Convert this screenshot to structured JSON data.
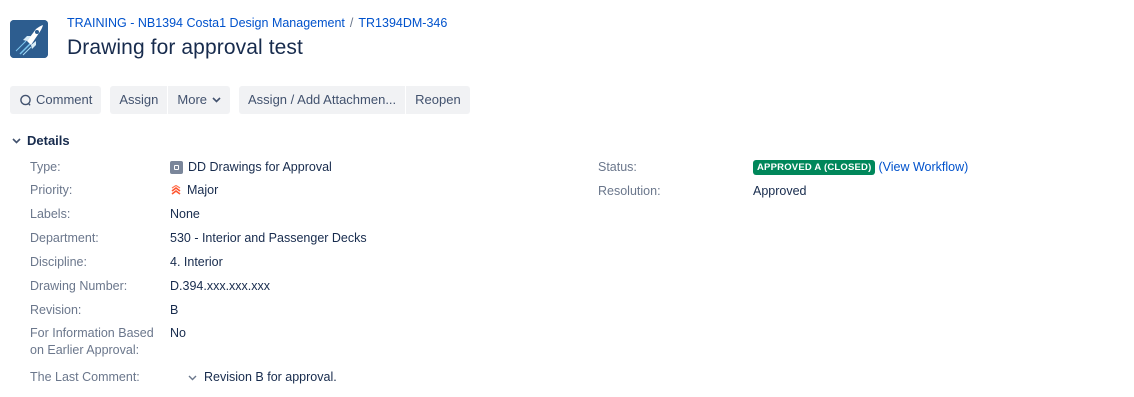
{
  "header": {
    "project_link": "TRAINING - NB1394 Costa1 Design Management",
    "separator": "/",
    "issue_key": "TR1394DM-346",
    "title": "Drawing for approval test",
    "avatar_icon": "rocket-icon"
  },
  "toolbar": {
    "comment_label": "Comment",
    "comment_icon": "comment-icon",
    "assign_label": "Assign",
    "more_label": "More",
    "assign_attach_label": "Assign / Add Attachmen...",
    "reopen_label": "Reopen"
  },
  "details": {
    "heading": "Details",
    "fields": {
      "type_label": "Type:",
      "type_value": "DD Drawings for Approval",
      "priority_label": "Priority:",
      "priority_value": "Major",
      "labels_label": "Labels:",
      "labels_value": "None",
      "department_label": "Department:",
      "department_value": "530 - Interior and Passenger Decks",
      "discipline_label": "Discipline:",
      "discipline_value": "4. Interior",
      "drawing_number_label": "Drawing Number:",
      "drawing_number_value": "D.394.xxx.xxx.xxx",
      "revision_label": "Revision:",
      "revision_value": "B",
      "info_label_line1": "For Information Based",
      "info_label_line2": "on Earlier Approval:",
      "info_value": "No",
      "last_comment_label": "The Last Comment:",
      "last_comment_value": "Revision B for approval."
    },
    "right": {
      "status_label": "Status:",
      "status_value": "APPROVED A (CLOSED)",
      "status_color": "#00875a",
      "workflow_link": "(View Workflow)",
      "resolution_label": "Resolution:",
      "resolution_value": "Approved"
    }
  },
  "colors": {
    "link": "#0052cc",
    "priority_major": "#ff5630",
    "button_bg": "#f1f2f4"
  }
}
